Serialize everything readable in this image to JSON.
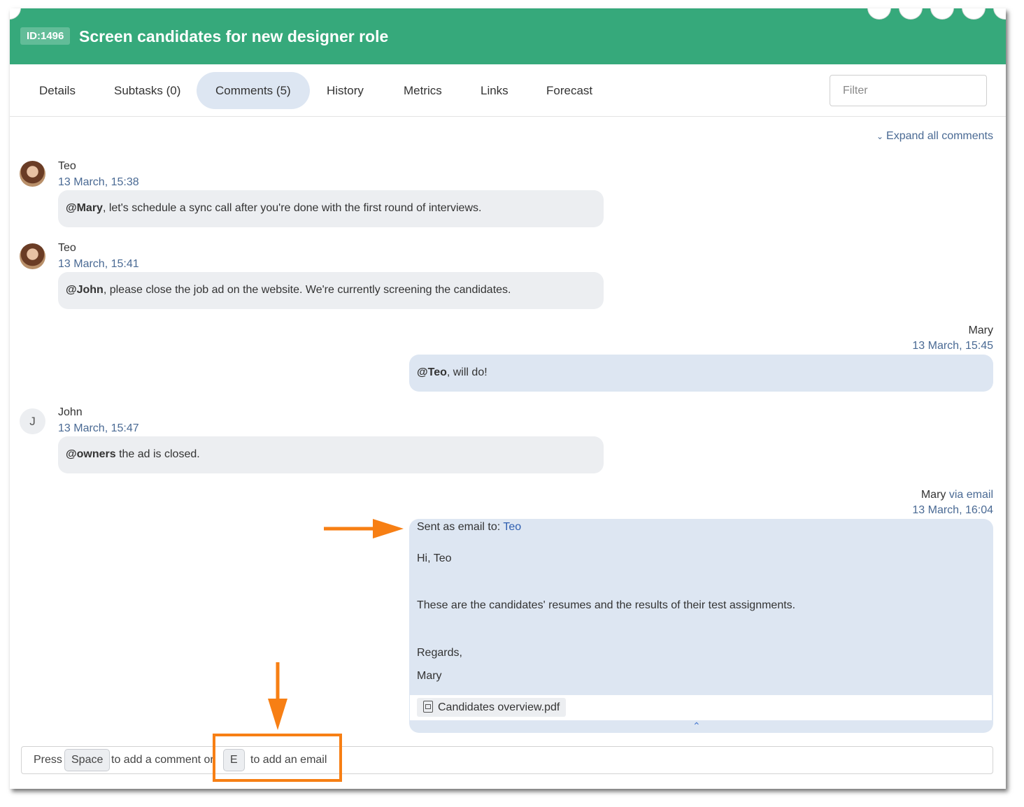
{
  "task": {
    "id": "ID:1496",
    "title": "Screen candidates for new designer role"
  },
  "header_icons": [
    "clock-icon",
    "print-icon",
    "share-icon",
    "plus-icon",
    "more-icon"
  ],
  "tabs": [
    {
      "label": "Details",
      "active": false
    },
    {
      "label": "Subtasks (0)",
      "active": false
    },
    {
      "label": "Comments (5)",
      "active": true
    },
    {
      "label": "History",
      "active": false
    },
    {
      "label": "Metrics",
      "active": false
    },
    {
      "label": "Links",
      "active": false
    },
    {
      "label": "Forecast",
      "active": false
    }
  ],
  "filter": {
    "placeholder": "Filter",
    "value": ""
  },
  "expand_all": "Expand all comments",
  "comments": [
    {
      "author": "Teo",
      "date": "13 March, 15:38",
      "avatar": "photo",
      "mention": "@Mary",
      "text": ", let's schedule a sync call after you're done with the first round of interviews."
    },
    {
      "author": "Teo",
      "date": "13 March, 15:41",
      "avatar": "photo",
      "mention": "@John",
      "text": ", please close the job ad on the website. We're currently screening the candidates."
    },
    {
      "author": "Mary",
      "date": "13 March, 15:45",
      "mention": "@Teo",
      "text": ", will do!"
    },
    {
      "author": "John",
      "date": "13 March, 15:47",
      "avatar": "J",
      "mention": "@owners",
      "text": " the ad is closed."
    },
    {
      "author": "Mary",
      "via": "via email",
      "date": "13 March, 16:04",
      "sent_label": "Sent as email to:",
      "sent_to": "Teo",
      "greeting": "Hi, Teo",
      "body": "These are the candidates' resumes and the results of their test assignments.",
      "closing": "Regards,",
      "signature": "Mary",
      "attachment": "Candidates overview.pdf"
    }
  ],
  "composer": {
    "press": "Press",
    "key_space": "Space",
    "mid": "to add a comment or",
    "key_e": "E",
    "end": "to add an email"
  },
  "colors": {
    "header": "#36a97b",
    "active_tab": "#dde6f2",
    "bubble_gray": "#eceef1",
    "bubble_blue": "#dde6f2",
    "date_text": "#4a6a94",
    "annotation": "#f77f14"
  }
}
